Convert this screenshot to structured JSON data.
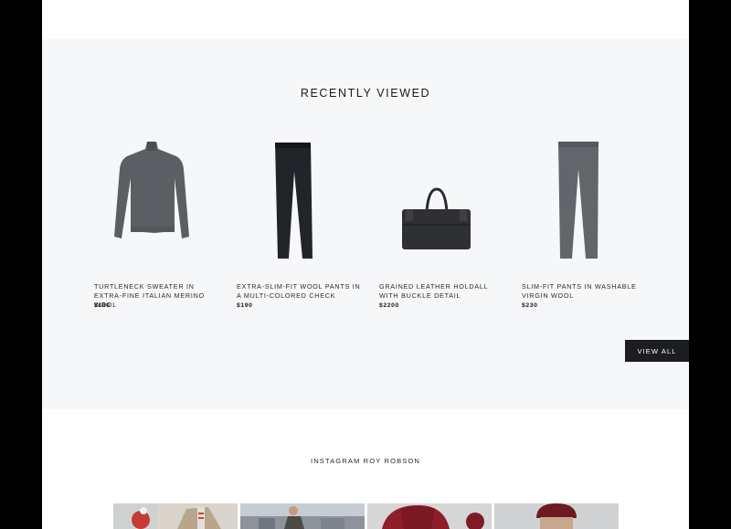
{
  "recently_viewed": {
    "title": "RECENTLY VIEWED",
    "view_all_label": "VIEW ALL",
    "products": [
      {
        "name": "TURTLENECK SWEATER IN EXTRA-FINE ITALIAN MERINO WOOL",
        "price": "$180",
        "image_icon": "sweater-icon"
      },
      {
        "name": "EXTRA-SLIM-FIT WOOL PANTS IN A MULTI-COLORED CHECK",
        "price": "$190",
        "image_icon": "pants-icon"
      },
      {
        "name": "GRAINED LEATHER HOLDALL WITH BUCKLE DETAIL",
        "price": "$2200",
        "image_icon": "bag-icon"
      },
      {
        "name": "SLIM-FIT PANTS IN WASHABLE VIRGIN WOOL",
        "price": "$230",
        "image_icon": "pants-icon"
      }
    ]
  },
  "instagram": {
    "title": "INSTAGRAM ROY ROBSON",
    "tiles": [
      "instagram-photo-1",
      "instagram-photo-2",
      "instagram-photo-3",
      "instagram-photo-4"
    ]
  },
  "colors": {
    "section_bg": "#f6f7f9",
    "button_bg": "#1c1d22",
    "frame_bg": "#000000"
  }
}
